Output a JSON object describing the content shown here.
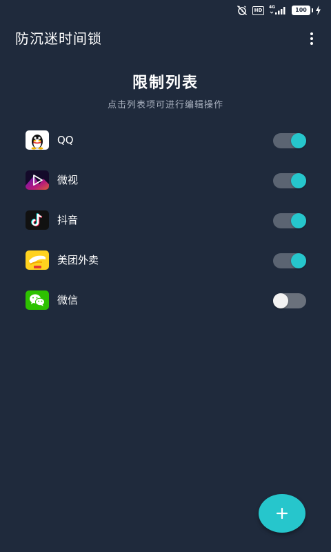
{
  "status_bar": {
    "network": "4G",
    "battery": "100",
    "icons": [
      "alarm-off-icon",
      "hd-icon",
      "signal-icon",
      "battery-icon",
      "charging-icon"
    ]
  },
  "app_bar": {
    "title": "防沉迷时间锁",
    "menu_icon": "more-vert-icon"
  },
  "header": {
    "title": "限制列表",
    "subtitle": "点击列表项可进行编辑操作"
  },
  "apps": [
    {
      "name": "QQ",
      "icon": "qq-icon",
      "enabled": true
    },
    {
      "name": "微视",
      "icon": "weishi-icon",
      "enabled": true
    },
    {
      "name": "抖音",
      "icon": "douyin-icon",
      "enabled": true
    },
    {
      "name": "美团外卖",
      "icon": "meituan-waimai-icon",
      "enabled": true
    },
    {
      "name": "微信",
      "icon": "wechat-icon",
      "enabled": false
    }
  ],
  "fab": {
    "icon": "plus-icon"
  },
  "colors": {
    "background": "#1f2a3c",
    "accent": "#26c6cc",
    "toggle_track": "#5b6472",
    "subtitle": "#aab2c0"
  }
}
